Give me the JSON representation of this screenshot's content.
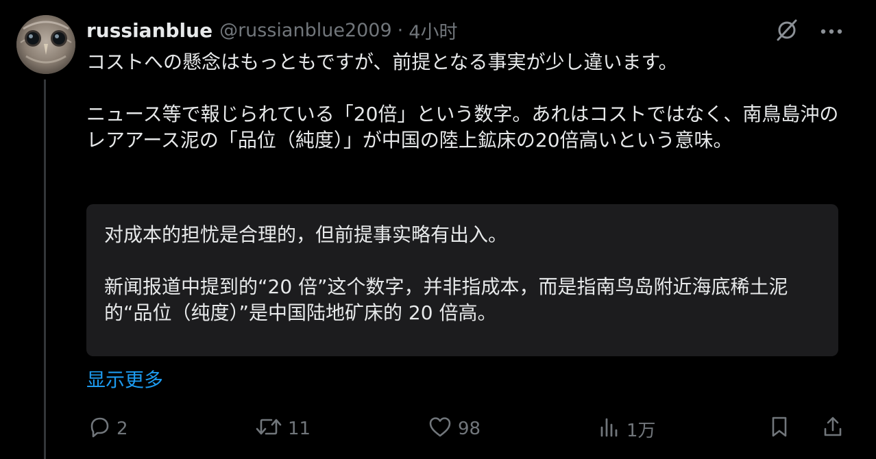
{
  "post": {
    "display_name": "russianblue",
    "handle": "@russianblue2009",
    "separator": "·",
    "time": "4小时",
    "paragraphs": [
      "コストへの懸念はもっともですが、前提となる事実が少し違います。",
      "ニュース等で報じられている「20倍」という数字。あれはコストではなく、南鳥島沖のレアアース泥の「品位（純度）」が中国の陸上鉱床の20倍高いという意味。"
    ],
    "translation": [
      "对成本的担忧是合理的，但前提事实略有出入。",
      "新闻报道中提到的“20 倍”这个数字，并非指成本，而是指南鸟岛附近海底稀土泥的“品位（纯度）”是中国陆地矿床的 20 倍高。"
    ],
    "show_more_label": "显示更多"
  },
  "actions": {
    "reply_count": "2",
    "repost_count": "11",
    "like_count": "98",
    "views_count": "1万"
  },
  "icons": {
    "grok": "grok-icon",
    "more": "more-icon",
    "reply": "reply-icon",
    "repost": "repost-icon",
    "like": "heart-icon",
    "views": "views-icon"
  },
  "colors": {
    "background": "#000000",
    "text": "#e7e9ea",
    "muted": "#71767b",
    "link": "#1d9bf0",
    "translation_bg": "#1c1c1e"
  }
}
